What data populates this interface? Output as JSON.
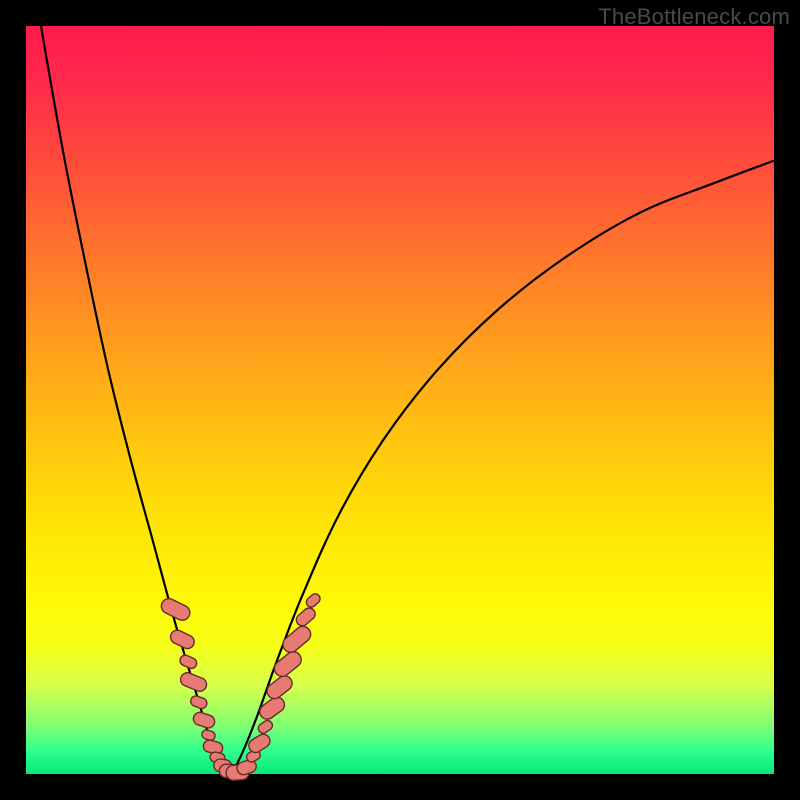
{
  "watermark": "TheBottleneck.com",
  "colors": {
    "frame": "#000000",
    "bead_fill": "#e77a72",
    "bead_stroke": "#642d27",
    "curve": "#000000"
  },
  "chart_data": {
    "type": "line",
    "title": "",
    "xlabel": "",
    "ylabel": "",
    "xlim": [
      0,
      100
    ],
    "ylim": [
      0,
      100
    ],
    "grid": false,
    "legend": false,
    "note": "Two smooth curves forming a V / asymmetric valley. Values are y as a function of x read from the plotted paths (0 = bottom/green, 100 = top/red). Pink bead-shaped markers cluster near the valley bottom on both branches.",
    "series": [
      {
        "name": "left-branch",
        "x": [
          2,
          5,
          8,
          11,
          14,
          17,
          20,
          23,
          24.5,
          26,
          27.5
        ],
        "values": [
          100,
          83,
          68,
          54,
          42,
          31,
          20,
          10,
          5,
          2,
          0
        ]
      },
      {
        "name": "right-branch",
        "x": [
          27.5,
          29,
          31,
          33.5,
          37,
          42,
          48,
          55,
          63,
          72,
          82,
          92,
          100
        ],
        "values": [
          0,
          3,
          8,
          15,
          24,
          35,
          45,
          54,
          62,
          69,
          75,
          79,
          82
        ]
      }
    ],
    "markers": {
      "name": "beads",
      "shape": "rounded-rect",
      "points": [
        {
          "x": 20.0,
          "y": 22,
          "w": 2.0,
          "h": 4.0,
          "rot": -64
        },
        {
          "x": 20.9,
          "y": 18,
          "w": 1.8,
          "h": 3.3,
          "rot": -64
        },
        {
          "x": 21.7,
          "y": 15,
          "w": 1.4,
          "h": 2.3,
          "rot": -66
        },
        {
          "x": 22.4,
          "y": 12.3,
          "w": 1.8,
          "h": 3.6,
          "rot": -68
        },
        {
          "x": 23.1,
          "y": 9.6,
          "w": 1.4,
          "h": 2.2,
          "rot": -70
        },
        {
          "x": 23.8,
          "y": 7.2,
          "w": 1.7,
          "h": 2.9,
          "rot": -72
        },
        {
          "x": 24.4,
          "y": 5.2,
          "w": 1.2,
          "h": 1.8,
          "rot": -74
        },
        {
          "x": 25.0,
          "y": 3.6,
          "w": 1.6,
          "h": 2.6,
          "rot": -76
        },
        {
          "x": 25.6,
          "y": 2.2,
          "w": 1.3,
          "h": 2.0,
          "rot": -78
        },
        {
          "x": 26.3,
          "y": 1.1,
          "w": 1.7,
          "h": 2.4,
          "rot": -82
        },
        {
          "x": 27.2,
          "y": 0.4,
          "w": 1.8,
          "h": 2.7,
          "rot": -88
        },
        {
          "x": 28.3,
          "y": 0.2,
          "w": 2.0,
          "h": 3.1,
          "rot": 86
        },
        {
          "x": 29.5,
          "y": 0.9,
          "w": 1.7,
          "h": 2.6,
          "rot": 72
        },
        {
          "x": 30.4,
          "y": 2.4,
          "w": 1.3,
          "h": 1.9,
          "rot": 62
        },
        {
          "x": 31.2,
          "y": 4.1,
          "w": 1.8,
          "h": 3.0,
          "rot": 58
        },
        {
          "x": 32.0,
          "y": 6.3,
          "w": 1.3,
          "h": 2.0,
          "rot": 56
        },
        {
          "x": 32.9,
          "y": 8.8,
          "w": 2.0,
          "h": 3.6,
          "rot": 54
        },
        {
          "x": 33.9,
          "y": 11.6,
          "w": 2.0,
          "h": 3.7,
          "rot": 52
        },
        {
          "x": 35.0,
          "y": 14.7,
          "w": 2.1,
          "h": 4.0,
          "rot": 51
        },
        {
          "x": 36.2,
          "y": 18.0,
          "w": 2.1,
          "h": 4.2,
          "rot": 50
        },
        {
          "x": 37.4,
          "y": 21.0,
          "w": 1.6,
          "h": 2.8,
          "rot": 49
        },
        {
          "x": 38.4,
          "y": 23.2,
          "w": 1.3,
          "h": 2.0,
          "rot": 48
        }
      ]
    }
  }
}
